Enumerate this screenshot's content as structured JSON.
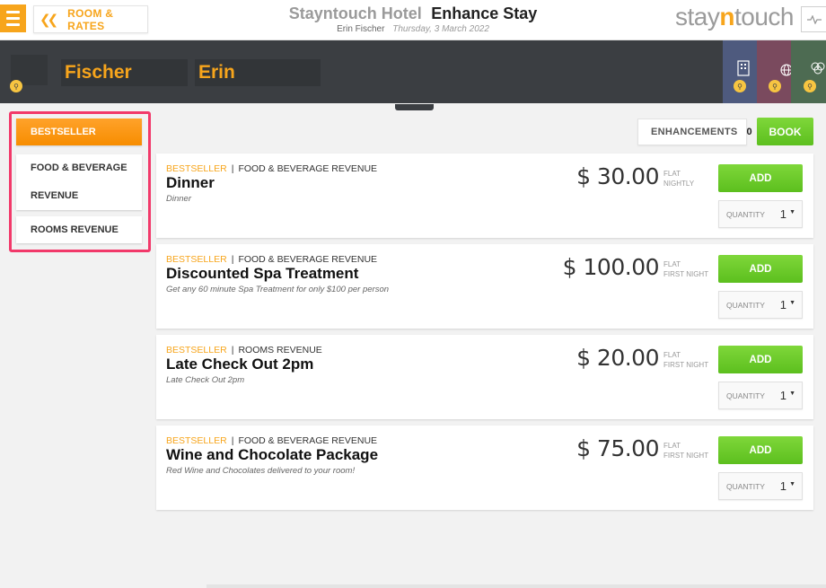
{
  "header": {
    "back_label": "ROOM & RATES",
    "hotel_name": "Stayntouch Hotel",
    "page_title": "Enhance Stay",
    "guest_name": "Erin Fischer",
    "date": "Thursday, 3 March 2022",
    "brand": {
      "pre": "stay",
      "mid": "n",
      "post": "touch"
    }
  },
  "guest": {
    "last_name": "Fischer",
    "first_name": "Erin"
  },
  "sidebar": {
    "items": [
      {
        "label": "BESTSELLER",
        "active": true
      },
      {
        "label_line1": "FOOD & BEVERAGE",
        "label_line2": "REVENUE",
        "active": false
      },
      {
        "label": "ROOMS REVENUE",
        "active": false
      }
    ]
  },
  "toolbar": {
    "enhancements_label": "ENHANCEMENTS",
    "enhancements_count": "0",
    "book_label": "BOOK"
  },
  "addons": [
    {
      "tag": "BESTSELLER",
      "category": "FOOD & BEVERAGE REVENUE",
      "name": "Dinner",
      "description": "Dinner",
      "price": "$ 30.00",
      "type_line1": "FLAT",
      "type_line2": "NIGHTLY",
      "add_label": "ADD",
      "qty_label": "QUANTITY",
      "qty_value": "1"
    },
    {
      "tag": "BESTSELLER",
      "category": "FOOD & BEVERAGE REVENUE",
      "name": "Discounted Spa Treatment",
      "description": "Get any 60 minute Spa Treatment for only $100 per person",
      "price": "$ 100.00",
      "type_line1": "FLAT",
      "type_line2": "FIRST NIGHT",
      "add_label": "ADD",
      "qty_label": "QUANTITY",
      "qty_value": "1"
    },
    {
      "tag": "BESTSELLER",
      "category": "ROOMS REVENUE",
      "name": "Late Check Out 2pm",
      "description": "Late Check Out 2pm",
      "price": "$ 20.00",
      "type_line1": "FLAT",
      "type_line2": "FIRST NIGHT",
      "add_label": "ADD",
      "qty_label": "QUANTITY",
      "qty_value": "1"
    },
    {
      "tag": "BESTSELLER",
      "category": "FOOD & BEVERAGE REVENUE",
      "name": "Wine and Chocolate Package",
      "description": "Red Wine and Chocolates delivered to your room!",
      "price": "$ 75.00",
      "type_line1": "FLAT",
      "type_line2": "FIRST NIGHT",
      "add_label": "ADD",
      "qty_label": "QUANTITY",
      "qty_value": "1"
    }
  ],
  "colors": {
    "accent": "#f7a51c",
    "green": "#5cbf1e",
    "highlight": "#f2396a",
    "banner": "#3b3e42",
    "tab_blue": "#4e5a7e",
    "tab_mauve": "#7a4a5e",
    "tab_green": "#4d6b52"
  },
  "icons": [
    "menu-icon",
    "double-chevron-left-icon",
    "pulse-icon",
    "zoom-icon",
    "building-icon",
    "globe-icon",
    "circles-icon",
    "caret-down-icon"
  ]
}
